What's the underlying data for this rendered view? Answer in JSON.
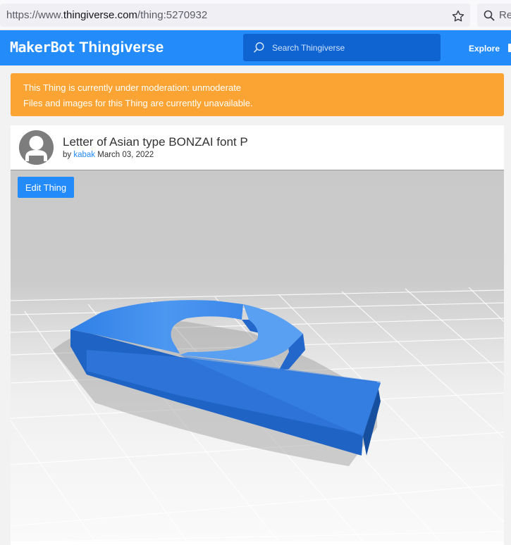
{
  "browser": {
    "url_prefix": "https://www.",
    "url_host": "thingiverse.com",
    "url_path": "/thing:5270932",
    "search_text": "Rec"
  },
  "nav": {
    "logo_maker": "MakerBot",
    "logo_thing": "Thingiverse",
    "search_placeholder": "Search Thingiverse",
    "explore_label": "Explore"
  },
  "banner": {
    "line1": "This Thing is currently under moderation: unmoderate",
    "line2": "Files and images for this Thing are currently unavailable."
  },
  "thing": {
    "title": "Letter of Asian type BONZAI font P",
    "by_label": "by",
    "author": "kabak",
    "date": "March 03, 2022",
    "edit_label": "Edit Thing"
  },
  "colors": {
    "brand_blue": "#248bfb",
    "banner_orange": "#fca433",
    "model_blue": "#2a78e0"
  }
}
